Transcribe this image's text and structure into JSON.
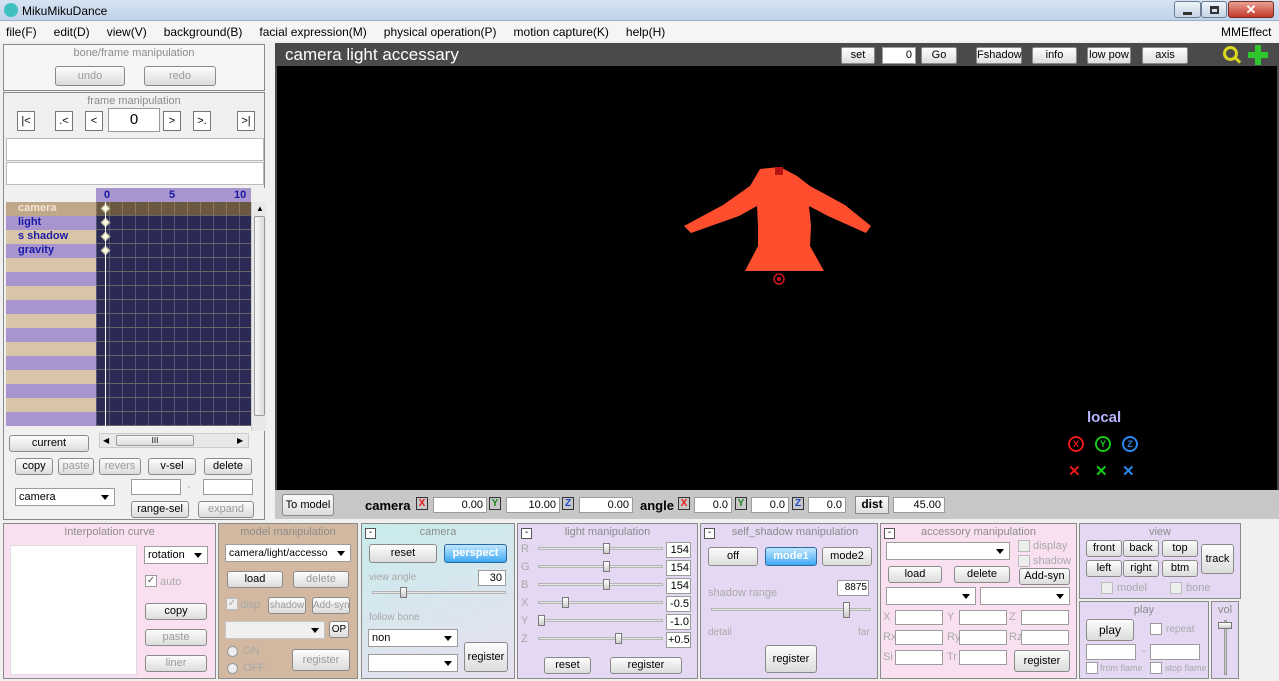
{
  "app": {
    "title": "MikuMikuDance"
  },
  "menu": [
    "file(F)",
    "edit(D)",
    "view(V)",
    "background(B)",
    "facial expression(M)",
    "physical operation(P)",
    "motion capture(K)",
    "help(H)"
  ],
  "menu_right": "MMEffect",
  "bone_frame": {
    "title": "bone/frame manipulation",
    "undo": "undo",
    "redo": "redo"
  },
  "frame_manip": {
    "title": "frame manipulation",
    "frame": "0",
    "first": "|<",
    "prev_key": ".<",
    "prev": "<",
    "next": ">",
    "next_key": ">.",
    "last": ">|"
  },
  "timeline": {
    "ticks": [
      "0",
      "5",
      "10"
    ],
    "rows": [
      "camera",
      "light",
      "s shadow",
      "gravity"
    ]
  },
  "left_bottom": {
    "current": "current",
    "copy": "copy",
    "paste": "paste",
    "revers": "revers",
    "vsel": "v-sel",
    "delete": "delete",
    "target": "camera",
    "dash": "-",
    "range_sel": "range-sel",
    "expand": "expand",
    "scroll_grip": "III"
  },
  "viewport": {
    "title": "camera light accessary",
    "set": "set",
    "frame": "0",
    "go": "Go",
    "fshadow": "Fshadow",
    "info": "info",
    "lowpow": "low pow",
    "axis": "axis",
    "local": "local",
    "to_model": "To model",
    "camera_label": "camera",
    "cx": "0.00",
    "cy": "10.00",
    "cz": "0.00",
    "angle_label": "angle",
    "ax": "0.0",
    "ay": "0.0",
    "az": "0.0",
    "dist_label": "dist",
    "dist": "45.00",
    "x": "X",
    "y": "Y",
    "z": "Z"
  },
  "interp": {
    "title": "Interpolation curve",
    "type": "rotation",
    "auto": "auto",
    "copy": "copy",
    "paste": "paste",
    "liner": "liner"
  },
  "model_manip": {
    "title": "model manipulation",
    "model": "camera/light/accesso",
    "load": "load",
    "delete": "delete",
    "disp": "disp",
    "shadow": "shadow",
    "addsyn": "Add-syn",
    "op": "OP",
    "on": "ON",
    "off": "OFF",
    "register": "register"
  },
  "camera_panel": {
    "title": "camera",
    "reset": "reset",
    "perspect": "perspect",
    "view_angle_label": "view angle",
    "view_angle": "30",
    "follow_bone": "follow bone",
    "bone": "non",
    "register": "register"
  },
  "light": {
    "title": "light manipulation",
    "labels": [
      "R",
      "G",
      "B",
      "X",
      "Y",
      "Z"
    ],
    "values": [
      "154",
      "154",
      "154",
      "-0.5",
      "-1.0",
      "+0.5"
    ],
    "reset": "reset",
    "register": "register"
  },
  "self_shadow": {
    "title": "self_shadow manipulation",
    "off": "off",
    "mode1": "mode1",
    "mode2": "mode2",
    "range_label": "shadow range",
    "range": "8875",
    "detail": "detail",
    "far": "far",
    "register": "register"
  },
  "accessory": {
    "title": "accessory manipulation",
    "display": "display",
    "shadow": "shadow",
    "load": "load",
    "delete": "delete",
    "addsyn": "Add-syn",
    "fields": [
      "X",
      "Y",
      "Z",
      "Rx",
      "Ry",
      "Rz",
      "Si",
      "Tr"
    ],
    "register": "register"
  },
  "view": {
    "title": "view",
    "front": "front",
    "back": "back",
    "top": "top",
    "left": "left",
    "right": "right",
    "btm": "btm",
    "track": "track",
    "model": "model",
    "bone": "bone"
  },
  "play": {
    "title": "play",
    "play": "play",
    "repeat": "repeat",
    "dash": "-",
    "from": "from flame",
    "stop": "stop flame"
  },
  "vol": {
    "title": "vol"
  },
  "colors": {
    "dress": "#ff4e2e",
    "timeline_purple": "#a995cd",
    "timeline_tan": "#d8c4a6"
  }
}
